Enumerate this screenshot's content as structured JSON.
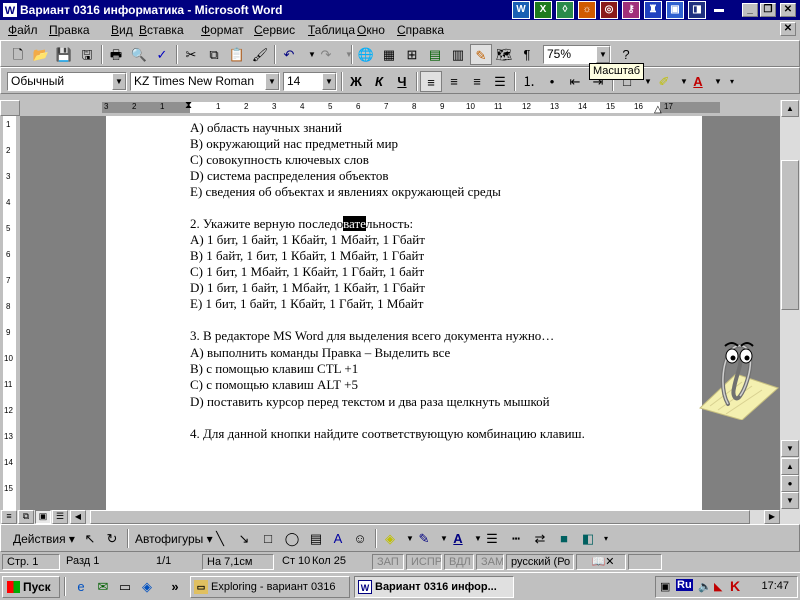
{
  "window": {
    "title": "Вариант 0316 информатика - Microsoft Word",
    "app_icon": "W"
  },
  "menu": [
    "Файл",
    "Правка",
    "Вид",
    "Вставка",
    "Формат",
    "Сервис",
    "Таблица",
    "Окно",
    "Справка"
  ],
  "toolbar": {
    "zoom": "75%",
    "tooltip": "Масштаб"
  },
  "format": {
    "style": "Обычный",
    "font": "KZ Times New Roman",
    "size": "14",
    "bold": "Ж",
    "italic": "К",
    "underline": "Ч"
  },
  "ruler": {
    "h_left": [
      "3",
      "2",
      "1"
    ],
    "h_right": [
      "1",
      "2",
      "3",
      "4",
      "5",
      "6",
      "7",
      "8",
      "9",
      "10",
      "11",
      "12",
      "13",
      "14",
      "15",
      "16",
      "17"
    ],
    "v": [
      "1",
      "2",
      "3",
      "4",
      "5",
      "6",
      "7",
      "8",
      "9",
      "10",
      "11",
      "12",
      "13",
      "14",
      "15"
    ]
  },
  "document": {
    "lines": [
      "A) область научных знаний",
      "B) окружающий нас предметный мир",
      "C) совокупность ключевых слов",
      "D) система распределения объектов",
      "E) сведения об объектах и явлениях окружающей среды",
      "",
      "",
      "A) 1 бит, 1 байт, 1 Кбайт, 1 Мбайт, 1 Гбайт",
      "B) 1 байт, 1 бит, 1 Кбайт, 1 Мбайт, 1 Гбайт",
      "C) 1 бит, 1 Мбайт, 1 Кбайт, 1 Гбайт, 1 байт",
      "D) 1 бит, 1 байт, 1 Мбайт, 1 Кбайт, 1 Гбайт",
      "E) 1 бит, 1 байт, 1 Кбайт, 1 Гбайт, 1 Мбайт",
      "",
      "3. В редакторе MS Word для выделения всего документа нужно…",
      "A) выполнить команды Правка – Выделить все",
      "B) с помощью клавиш CTL +1",
      "C) с помощью клавиш ALT +5",
      "D) поставить курсор перед текстом и два раза щелкнуть мышкой",
      "",
      "4. Для данной кнопки  найдите соответствующую комбинацию клавиш."
    ],
    "q2_before": "2. Укажите верную последо",
    "q2_selected": "вате",
    "q2_after": "льность:"
  },
  "drawing": {
    "actions": "Действия",
    "autoshapes": "Автофигуры"
  },
  "status": {
    "page": "Стр. 1",
    "section": "Разд 1",
    "pages": "1/1",
    "at": "На 7,1см",
    "line": "Ст 10",
    "col": "Кол 25",
    "rec": "ЗАП",
    "trk": "ИСПР",
    "ext": "ВДЛ",
    "ovr": "ЗАМ",
    "lang": "русский (Ро"
  },
  "taskbar": {
    "start": "Пуск",
    "tasks": [
      "Exploring - вариант 0316",
      "Вариант 0316 инфор..."
    ],
    "lang": "Ru",
    "clock": "17:47"
  },
  "colors": {
    "titlebar": "#000080",
    "chrome": "#c0c0c0",
    "selection": "#000000"
  }
}
